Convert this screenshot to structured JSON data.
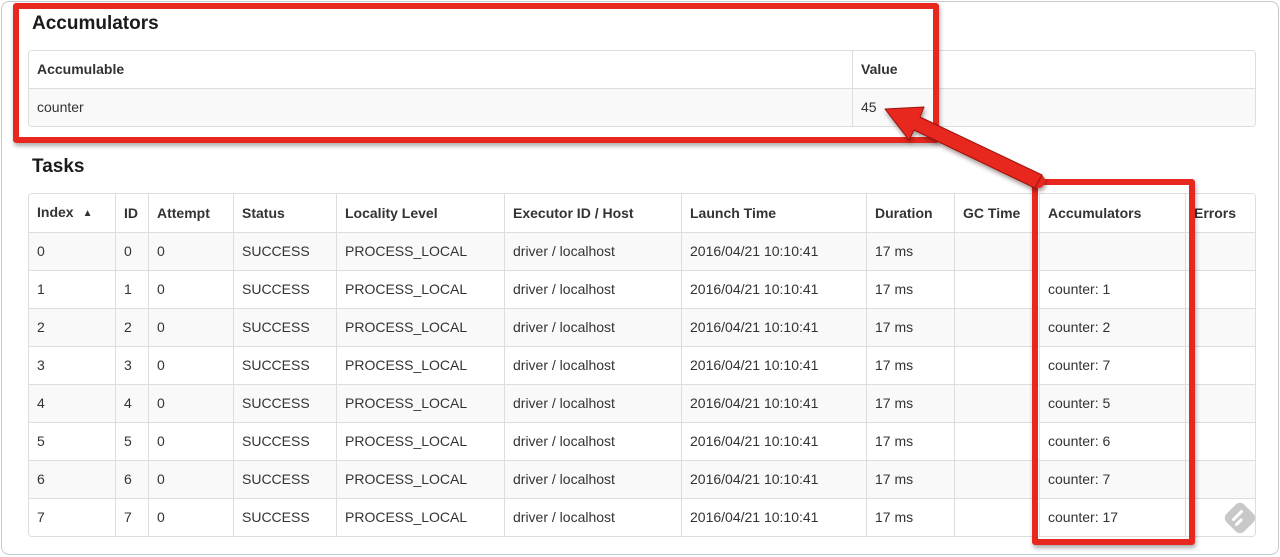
{
  "accumulators_section": {
    "title": "Accumulators",
    "table": {
      "columns": [
        "Accumulable",
        "Value"
      ],
      "rows": [
        {
          "accumulable": "counter",
          "value": "45"
        }
      ]
    }
  },
  "tasks_section": {
    "title": "Tasks",
    "table": {
      "columns": [
        "Index",
        "ID",
        "Attempt",
        "Status",
        "Locality Level",
        "Executor ID / Host",
        "Launch Time",
        "Duration",
        "GC Time",
        "Accumulators",
        "Errors"
      ],
      "sort": {
        "column": "Index",
        "direction": "ascending",
        "icon": "▲"
      },
      "rows": [
        [
          "0",
          "0",
          "0",
          "SUCCESS",
          "PROCESS_LOCAL",
          "driver / localhost",
          "2016/04/21 10:10:41",
          "17 ms",
          "",
          "",
          ""
        ],
        [
          "1",
          "1",
          "0",
          "SUCCESS",
          "PROCESS_LOCAL",
          "driver / localhost",
          "2016/04/21 10:10:41",
          "17 ms",
          "",
          "counter: 1",
          ""
        ],
        [
          "2",
          "2",
          "0",
          "SUCCESS",
          "PROCESS_LOCAL",
          "driver / localhost",
          "2016/04/21 10:10:41",
          "17 ms",
          "",
          "counter: 2",
          ""
        ],
        [
          "3",
          "3",
          "0",
          "SUCCESS",
          "PROCESS_LOCAL",
          "driver / localhost",
          "2016/04/21 10:10:41",
          "17 ms",
          "",
          "counter: 7",
          ""
        ],
        [
          "4",
          "4",
          "0",
          "SUCCESS",
          "PROCESS_LOCAL",
          "driver / localhost",
          "2016/04/21 10:10:41",
          "17 ms",
          "",
          "counter: 5",
          ""
        ],
        [
          "5",
          "5",
          "0",
          "SUCCESS",
          "PROCESS_LOCAL",
          "driver / localhost",
          "2016/04/21 10:10:41",
          "17 ms",
          "",
          "counter: 6",
          ""
        ],
        [
          "6",
          "6",
          "0",
          "SUCCESS",
          "PROCESS_LOCAL",
          "driver / localhost",
          "2016/04/21 10:10:41",
          "17 ms",
          "",
          "counter: 7",
          ""
        ],
        [
          "7",
          "7",
          "0",
          "SUCCESS",
          "PROCESS_LOCAL",
          "driver / localhost",
          "2016/04/21 10:10:41",
          "17 ms",
          "",
          "counter: 17",
          ""
        ]
      ]
    }
  },
  "annotations": {
    "highlight_color": "#e8271e",
    "box_summary": "accumulators-summary-table",
    "box_column": "tasks-accumulators-column",
    "arrow": "accumulators-column-to-total-value"
  },
  "watermark_icon": "screenshot-tool-watermark"
}
